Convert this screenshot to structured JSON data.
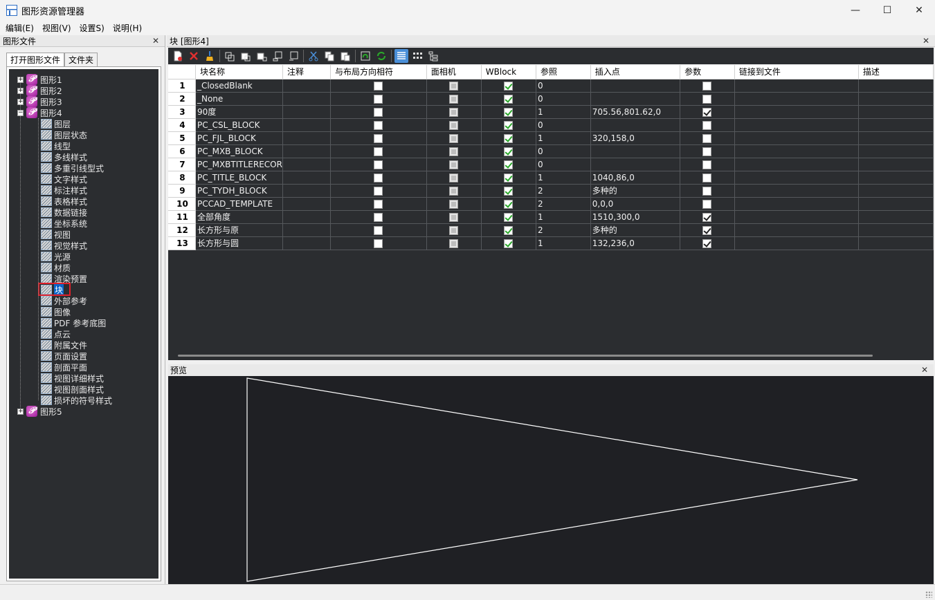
{
  "window": {
    "title": "图形资源管理器",
    "minimize": "—",
    "maximize": "☐",
    "close": "✕"
  },
  "menu": [
    "编辑(E)",
    "视图(V)",
    "设置S)",
    "说明(H)"
  ],
  "left": {
    "header": "图形文件",
    "close": "✕",
    "tabs": [
      "打开图形文件",
      "文件夹"
    ],
    "drawings": [
      "图形1",
      "图形2",
      "图形3",
      "图形4",
      "图形5"
    ],
    "children": [
      "图层",
      "图层状态",
      "线型",
      "多线样式",
      "多重引线型式",
      "文字样式",
      "标注样式",
      "表格样式",
      "数据链接",
      "坐标系统",
      "视图",
      "视觉样式",
      "光源",
      "材质",
      "渲染预置",
      "块",
      "外部参考",
      "图像",
      "PDF 参考底图",
      "点云",
      "附属文件",
      "页面设置",
      "剖面平面",
      "视图详细样式",
      "视图剖面样式",
      "损坏的符号样式"
    ],
    "selected_child": "块"
  },
  "right": {
    "header": "块 [图形4]",
    "close": "✕",
    "columns": [
      "块名称",
      "注释",
      "与布局方向相符",
      "面相机",
      "WBlock",
      "参照",
      "插入点",
      "参数",
      "链接到文件",
      "描述"
    ],
    "rows": [
      {
        "num": "1",
        "name": "_ClosedBlank",
        "note": "",
        "match": false,
        "wblock": true,
        "ref": "0",
        "insert": "",
        "param": false
      },
      {
        "num": "2",
        "name": "_None",
        "note": "",
        "match": false,
        "wblock": true,
        "ref": "0",
        "insert": "",
        "param": false
      },
      {
        "num": "3",
        "name": "90度",
        "note": "",
        "match": false,
        "wblock": true,
        "ref": "1",
        "insert": "705.56,801.62,0",
        "param": true
      },
      {
        "num": "4",
        "name": "PC_CSL_BLOCK",
        "note": "",
        "match": false,
        "wblock": true,
        "ref": "0",
        "insert": "",
        "param": false
      },
      {
        "num": "5",
        "name": "PC_FJL_BLOCK",
        "note": "",
        "match": false,
        "wblock": true,
        "ref": "1",
        "insert": "320,158,0",
        "param": false
      },
      {
        "num": "6",
        "name": "PC_MXB_BLOCK",
        "note": "",
        "match": false,
        "wblock": true,
        "ref": "0",
        "insert": "",
        "param": false
      },
      {
        "num": "7",
        "name": "PC_MXBTITLERECOR",
        "note": "",
        "match": false,
        "wblock": true,
        "ref": "0",
        "insert": "",
        "param": false
      },
      {
        "num": "8",
        "name": "PC_TITLE_BLOCK",
        "note": "",
        "match": false,
        "wblock": true,
        "ref": "1",
        "insert": "1040,86,0",
        "param": false
      },
      {
        "num": "9",
        "name": "PC_TYDH_BLOCK",
        "note": "",
        "match": false,
        "wblock": true,
        "ref": "2",
        "insert": "多种的",
        "param": false
      },
      {
        "num": "10",
        "name": "PCCAD_TEMPLATE",
        "note": "",
        "match": false,
        "wblock": true,
        "ref": "2",
        "insert": "0,0,0",
        "param": false
      },
      {
        "num": "11",
        "name": "全部角度",
        "note": "",
        "match": false,
        "wblock": true,
        "ref": "1",
        "insert": "1510,300,0",
        "param": true
      },
      {
        "num": "12",
        "name": "长方形与原",
        "note": "",
        "match": false,
        "wblock": true,
        "ref": "2",
        "insert": "多种的",
        "param": true
      },
      {
        "num": "13",
        "name": "长方形与圆",
        "note": "",
        "match": false,
        "wblock": true,
        "ref": "1",
        "insert": "132,236,0",
        "param": true
      }
    ],
    "preview_header": "预览",
    "preview_close": "✕"
  },
  "toolbar_icons": [
    "new-icon",
    "delete-icon",
    "purge-icon",
    "copy-blocks-icon",
    "paste-blocks-icon",
    "insert-icon",
    "redefine-icon",
    "export-icon",
    "cut-icon",
    "copy-icon",
    "paste-icon",
    "load-icon",
    "refresh-icon",
    "list-view-icon",
    "icon-view-icon",
    "tree-view-icon"
  ],
  "colors": {
    "accent": "#0a64c8",
    "dark_bg": "#2b2d30",
    "highlight_border": "#e0202a"
  }
}
